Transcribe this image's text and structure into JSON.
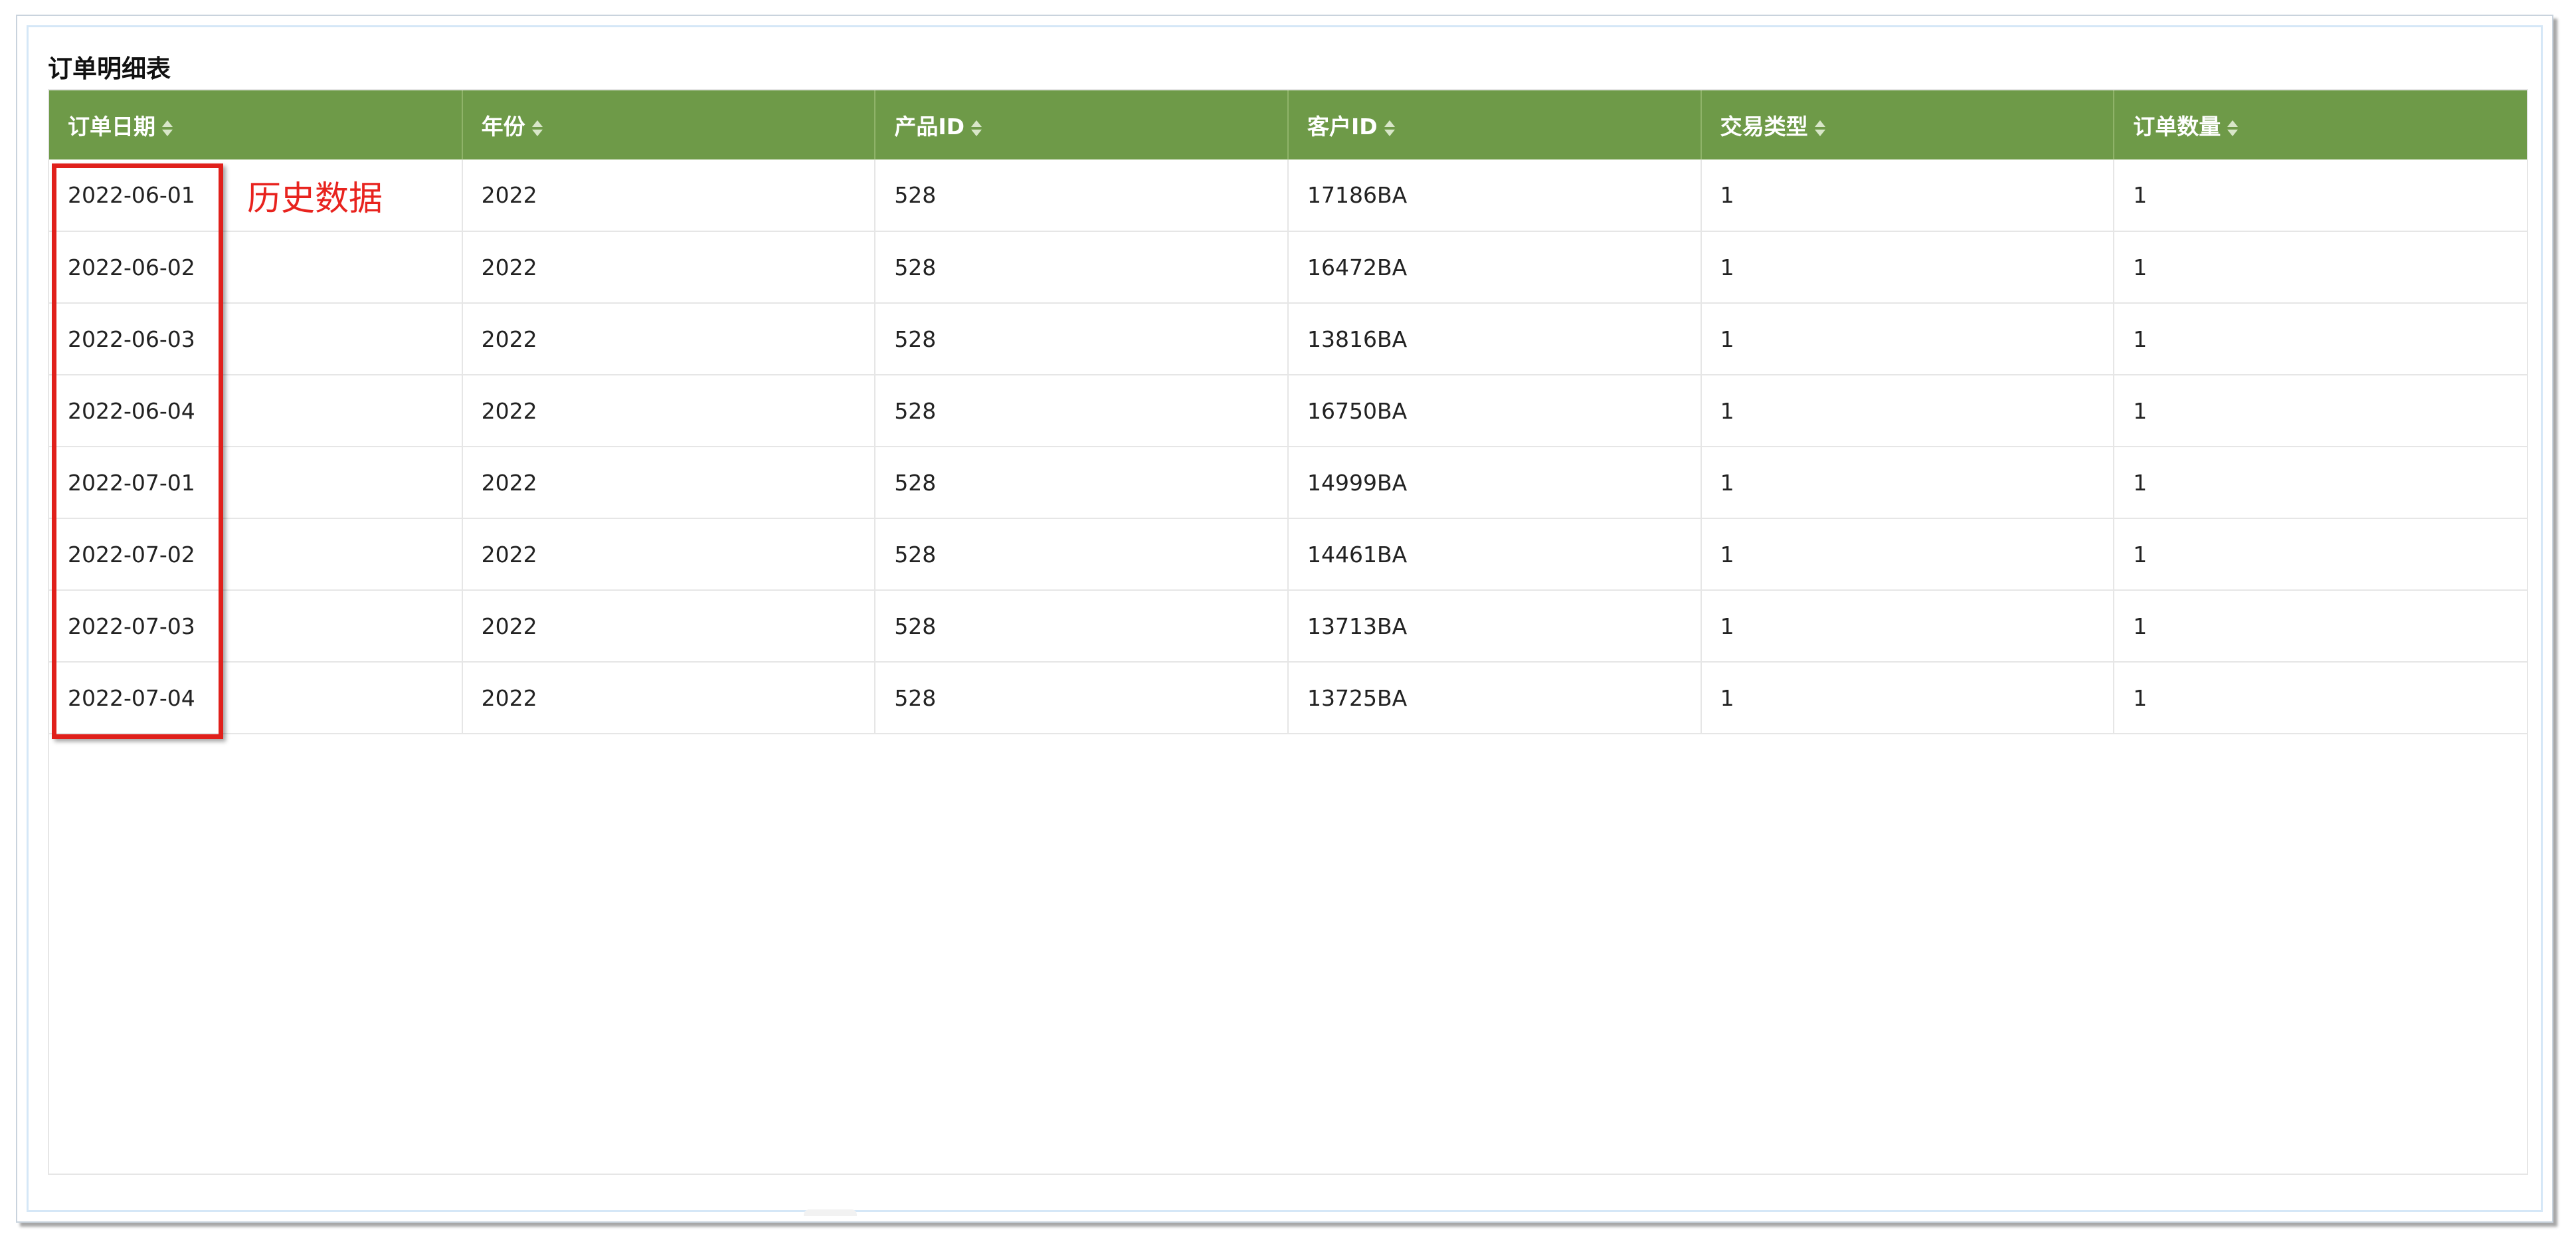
{
  "panel": {
    "title": "订单明细表"
  },
  "table": {
    "columns": [
      "订单日期",
      "年份",
      "产品ID",
      "客户ID",
      "交易类型",
      "订单数量"
    ],
    "rows": [
      [
        "2022-06-01",
        "2022",
        "528",
        "17186BA",
        "1",
        "1"
      ],
      [
        "2022-06-02",
        "2022",
        "528",
        "16472BA",
        "1",
        "1"
      ],
      [
        "2022-06-03",
        "2022",
        "528",
        "13816BA",
        "1",
        "1"
      ],
      [
        "2022-06-04",
        "2022",
        "528",
        "16750BA",
        "1",
        "1"
      ],
      [
        "2022-07-01",
        "2022",
        "528",
        "14999BA",
        "1",
        "1"
      ],
      [
        "2022-07-02",
        "2022",
        "528",
        "14461BA",
        "1",
        "1"
      ],
      [
        "2022-07-03",
        "2022",
        "528",
        "13713BA",
        "1",
        "1"
      ],
      [
        "2022-07-04",
        "2022",
        "528",
        "13725BA",
        "1",
        "1"
      ]
    ]
  },
  "annotation": {
    "label": "历史数据",
    "color": "#e0201b"
  },
  "colors": {
    "header_bg": "#6e9a48",
    "header_text": "#ffffff"
  },
  "icons": {
    "sort": "sort-icon"
  }
}
